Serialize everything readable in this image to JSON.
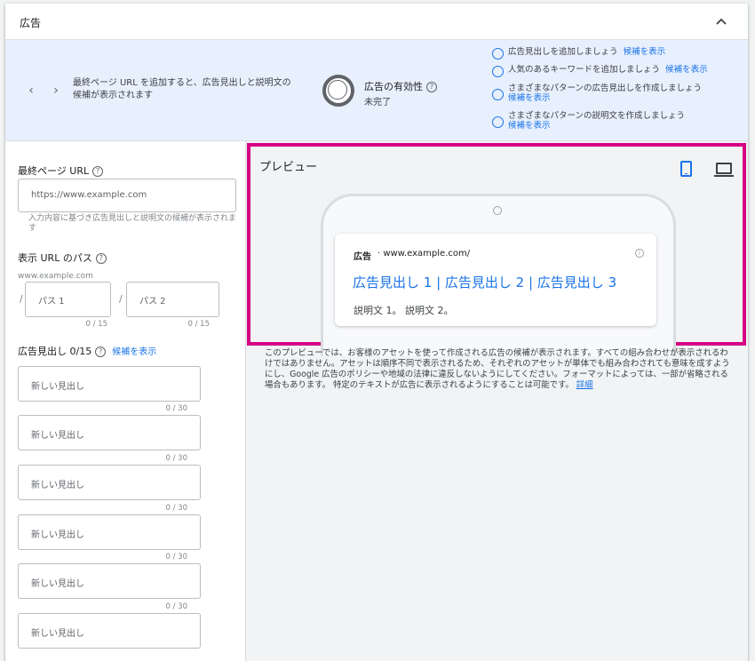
{
  "section": {
    "title": "広告"
  },
  "banner": {
    "text": "最終ページ URL を追加すると、広告見出しと説明文の候補が表示されます",
    "strength_label": "広告の有効性",
    "strength_status": "未完了",
    "suggestions": [
      {
        "text": "広告見出しを追加しましょう",
        "link": "候補を表示"
      },
      {
        "text": "人気のあるキーワードを追加しましょう",
        "link": "候補を表示"
      },
      {
        "text": "さまざまなパターンの広告見出しを作成しましょう",
        "link": "候補を表示"
      },
      {
        "text": "さまざまなパターンの説明文を作成しましょう",
        "link": "候補を表示"
      }
    ]
  },
  "form": {
    "final_url_label": "最終ページ URL",
    "final_url_placeholder": "https://www.example.com",
    "final_url_hint": "入力内容に基づき広告見出しと説明文の候補が表示されます",
    "display_path_label": "表示 URL のパス",
    "display_domain": "www.example.com",
    "path_sep": "/",
    "path1_placeholder": "パス 1",
    "path2_placeholder": "パス 2",
    "path_counter": "0 / 15",
    "headlines_label": "広告見出し 0/15",
    "headlines_link": "候補を表示",
    "headline_placeholder": "新しい見出し",
    "headline_counter": "0 / 30"
  },
  "preview": {
    "title": "プレビュー",
    "ad_tag": "広告",
    "ad_url": "· www.example.com/",
    "ad_headline": "広告見出し 1 | 広告見出し 2 | 広告見出し 3",
    "ad_description": "説明文 1。 説明文 2。",
    "note": "このプレビューでは、お客様のアセットを使って作成される広告の候補が表示されます。すべての組み合わせが表示されるわけではありません。アセットは順序不同で表示されるため、それぞれのアセットが単体でも組み合わされても意味を成すようにし、Google 広告のポリシーや地域の法律に違反しないようにしてください。フォーマットによっては、一部が省略される場合もあります。 特定のテキストが広告に表示されるようにすることは可能です。",
    "note_link": "詳細"
  },
  "colors": {
    "accent": "#1a73e8",
    "highlight_border": "#d50083",
    "banner_bg": "#e8f0fe"
  },
  "icons": [
    "chevron-up-icon",
    "chevron-left-icon",
    "chevron-right-icon",
    "help-icon",
    "mobile-icon",
    "desktop-icon",
    "info-icon"
  ]
}
